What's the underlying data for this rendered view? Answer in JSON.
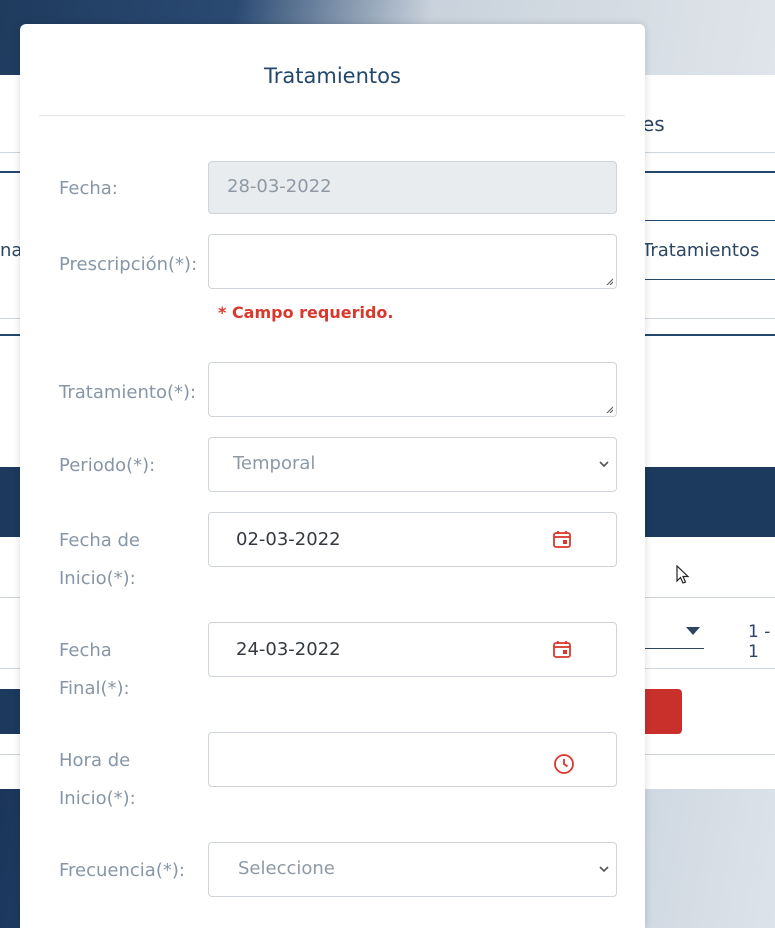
{
  "background": {
    "header_fragment": "es",
    "left_fragment": "na",
    "tab_label": "Tratamientos",
    "pager_text": "1 - 1"
  },
  "modal": {
    "title": "Tratamientos",
    "fields": {
      "fecha": {
        "label": "Fecha:",
        "value": "28-03-2022"
      },
      "prescripcion": {
        "label": "Prescripción(*):",
        "value": "",
        "error": "* Campo requerido."
      },
      "tratamiento": {
        "label": "Tratamiento(*):",
        "value": ""
      },
      "periodo": {
        "label": "Periodo(*):",
        "value": "Temporal"
      },
      "fecha_inicio": {
        "label_line1": "Fecha de",
        "label_line2": "Inicio(*):",
        "value": "02-03-2022"
      },
      "fecha_final": {
        "label_line1": "Fecha",
        "label_line2": "Final(*):",
        "value": "24-03-2022"
      },
      "hora_inicio": {
        "label_line1": "Hora de",
        "label_line2": "Inicio(*):",
        "value": ""
      },
      "frecuencia": {
        "label": "Frecuencia(*):",
        "value": "Seleccione"
      }
    }
  },
  "colors": {
    "accent": "#23476d",
    "error": "#d9382d",
    "icon": "#d9382d"
  }
}
